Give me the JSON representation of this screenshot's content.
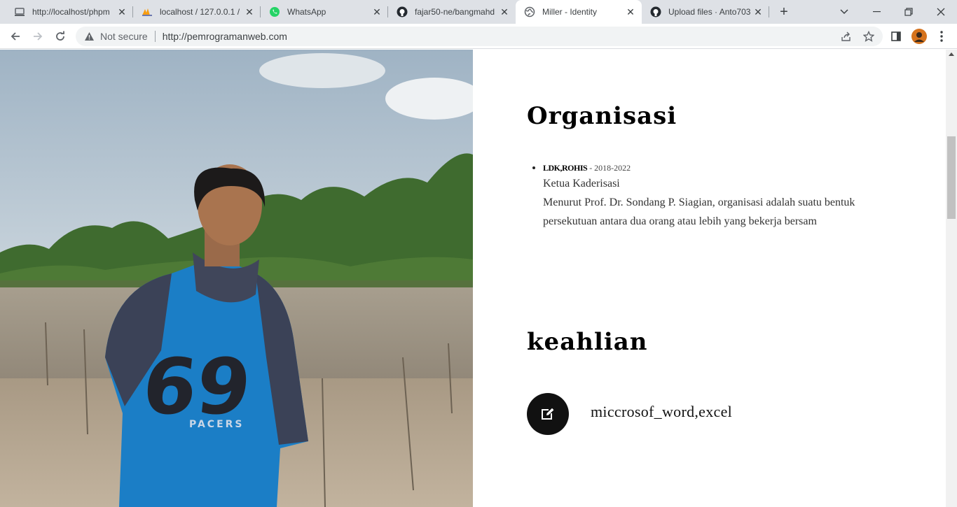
{
  "browser": {
    "tabs": [
      {
        "title": "http://localhost/phpm",
        "icon": "localhost-icon",
        "active": false
      },
      {
        "title": "localhost / 127.0.0.1 /",
        "icon": "phpmyadmin-icon",
        "active": false
      },
      {
        "title": "WhatsApp",
        "icon": "whatsapp-icon",
        "active": false
      },
      {
        "title": "fajar50-ne/bangmahd",
        "icon": "github-icon",
        "active": false
      },
      {
        "title": "Miller - Identity",
        "icon": "globe-icon",
        "active": true
      },
      {
        "title": "Upload files · Anto703",
        "icon": "github-icon",
        "active": false
      }
    ],
    "security_label": "Not secure",
    "url": "http://pemrogramanweb.com"
  },
  "page": {
    "organisasi": {
      "heading": "Organisasi",
      "items": [
        {
          "name": "LDK,ROHIS",
          "years": " - 2018-2022",
          "role": "Ketua Kaderisasi",
          "description": "Menurut Prof. Dr. Sondang P. Siagian, organisasi adalah suatu bentuk persekutuan antara dua orang atau lebih yang bekerja bersam"
        }
      ]
    },
    "keahlian": {
      "heading": "keahlian",
      "skills": [
        {
          "label": "miccrosof_word,excel",
          "icon": "edit-icon"
        }
      ]
    }
  }
}
